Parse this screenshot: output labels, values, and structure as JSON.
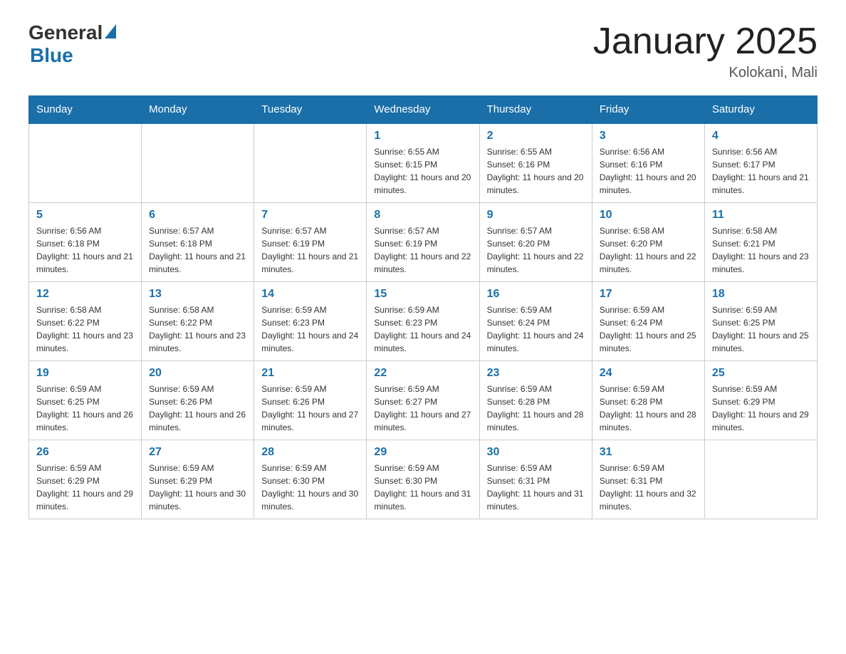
{
  "header": {
    "logo_general": "General",
    "logo_blue": "Blue",
    "title": "January 2025",
    "subtitle": "Kolokani, Mali"
  },
  "days_of_week": [
    "Sunday",
    "Monday",
    "Tuesday",
    "Wednesday",
    "Thursday",
    "Friday",
    "Saturday"
  ],
  "weeks": [
    [
      {
        "day": "",
        "info": ""
      },
      {
        "day": "",
        "info": ""
      },
      {
        "day": "",
        "info": ""
      },
      {
        "day": "1",
        "info": "Sunrise: 6:55 AM\nSunset: 6:15 PM\nDaylight: 11 hours and 20 minutes."
      },
      {
        "day": "2",
        "info": "Sunrise: 6:55 AM\nSunset: 6:16 PM\nDaylight: 11 hours and 20 minutes."
      },
      {
        "day": "3",
        "info": "Sunrise: 6:56 AM\nSunset: 6:16 PM\nDaylight: 11 hours and 20 minutes."
      },
      {
        "day": "4",
        "info": "Sunrise: 6:56 AM\nSunset: 6:17 PM\nDaylight: 11 hours and 21 minutes."
      }
    ],
    [
      {
        "day": "5",
        "info": "Sunrise: 6:56 AM\nSunset: 6:18 PM\nDaylight: 11 hours and 21 minutes."
      },
      {
        "day": "6",
        "info": "Sunrise: 6:57 AM\nSunset: 6:18 PM\nDaylight: 11 hours and 21 minutes."
      },
      {
        "day": "7",
        "info": "Sunrise: 6:57 AM\nSunset: 6:19 PM\nDaylight: 11 hours and 21 minutes."
      },
      {
        "day": "8",
        "info": "Sunrise: 6:57 AM\nSunset: 6:19 PM\nDaylight: 11 hours and 22 minutes."
      },
      {
        "day": "9",
        "info": "Sunrise: 6:57 AM\nSunset: 6:20 PM\nDaylight: 11 hours and 22 minutes."
      },
      {
        "day": "10",
        "info": "Sunrise: 6:58 AM\nSunset: 6:20 PM\nDaylight: 11 hours and 22 minutes."
      },
      {
        "day": "11",
        "info": "Sunrise: 6:58 AM\nSunset: 6:21 PM\nDaylight: 11 hours and 23 minutes."
      }
    ],
    [
      {
        "day": "12",
        "info": "Sunrise: 6:58 AM\nSunset: 6:22 PM\nDaylight: 11 hours and 23 minutes."
      },
      {
        "day": "13",
        "info": "Sunrise: 6:58 AM\nSunset: 6:22 PM\nDaylight: 11 hours and 23 minutes."
      },
      {
        "day": "14",
        "info": "Sunrise: 6:59 AM\nSunset: 6:23 PM\nDaylight: 11 hours and 24 minutes."
      },
      {
        "day": "15",
        "info": "Sunrise: 6:59 AM\nSunset: 6:23 PM\nDaylight: 11 hours and 24 minutes."
      },
      {
        "day": "16",
        "info": "Sunrise: 6:59 AM\nSunset: 6:24 PM\nDaylight: 11 hours and 24 minutes."
      },
      {
        "day": "17",
        "info": "Sunrise: 6:59 AM\nSunset: 6:24 PM\nDaylight: 11 hours and 25 minutes."
      },
      {
        "day": "18",
        "info": "Sunrise: 6:59 AM\nSunset: 6:25 PM\nDaylight: 11 hours and 25 minutes."
      }
    ],
    [
      {
        "day": "19",
        "info": "Sunrise: 6:59 AM\nSunset: 6:25 PM\nDaylight: 11 hours and 26 minutes."
      },
      {
        "day": "20",
        "info": "Sunrise: 6:59 AM\nSunset: 6:26 PM\nDaylight: 11 hours and 26 minutes."
      },
      {
        "day": "21",
        "info": "Sunrise: 6:59 AM\nSunset: 6:26 PM\nDaylight: 11 hours and 27 minutes."
      },
      {
        "day": "22",
        "info": "Sunrise: 6:59 AM\nSunset: 6:27 PM\nDaylight: 11 hours and 27 minutes."
      },
      {
        "day": "23",
        "info": "Sunrise: 6:59 AM\nSunset: 6:28 PM\nDaylight: 11 hours and 28 minutes."
      },
      {
        "day": "24",
        "info": "Sunrise: 6:59 AM\nSunset: 6:28 PM\nDaylight: 11 hours and 28 minutes."
      },
      {
        "day": "25",
        "info": "Sunrise: 6:59 AM\nSunset: 6:29 PM\nDaylight: 11 hours and 29 minutes."
      }
    ],
    [
      {
        "day": "26",
        "info": "Sunrise: 6:59 AM\nSunset: 6:29 PM\nDaylight: 11 hours and 29 minutes."
      },
      {
        "day": "27",
        "info": "Sunrise: 6:59 AM\nSunset: 6:29 PM\nDaylight: 11 hours and 30 minutes."
      },
      {
        "day": "28",
        "info": "Sunrise: 6:59 AM\nSunset: 6:30 PM\nDaylight: 11 hours and 30 minutes."
      },
      {
        "day": "29",
        "info": "Sunrise: 6:59 AM\nSunset: 6:30 PM\nDaylight: 11 hours and 31 minutes."
      },
      {
        "day": "30",
        "info": "Sunrise: 6:59 AM\nSunset: 6:31 PM\nDaylight: 11 hours and 31 minutes."
      },
      {
        "day": "31",
        "info": "Sunrise: 6:59 AM\nSunset: 6:31 PM\nDaylight: 11 hours and 32 minutes."
      },
      {
        "day": "",
        "info": ""
      }
    ]
  ]
}
